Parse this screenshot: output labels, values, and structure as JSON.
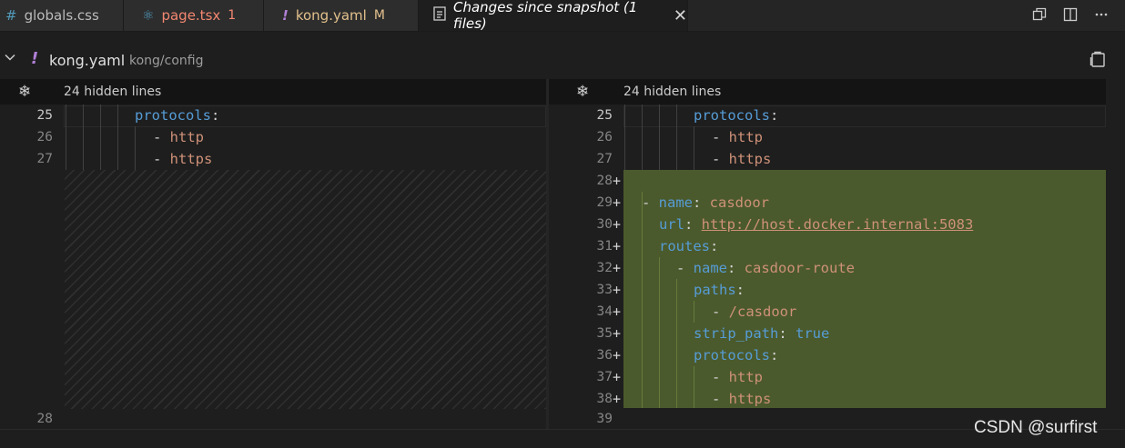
{
  "tabs": [
    {
      "icon": "#",
      "label": "globals.css",
      "badge": ""
    },
    {
      "icon": "⚛",
      "label": "page.tsx",
      "badge": "1"
    },
    {
      "icon": "!",
      "label": "kong.yaml",
      "badge": "M"
    },
    {
      "icon": "",
      "label": "Changes since snapshot (1 files)",
      "badge": ""
    }
  ],
  "colors": {
    "tab_error": "#f48771",
    "tab_modified": "#e2c08d",
    "added_bg": "#4b5a2c",
    "yaml_key": "#569cd6",
    "yaml_string": "#ce9178"
  },
  "header": {
    "file_name": "kong.yaml",
    "file_path": "kong/config"
  },
  "left": {
    "hidden_lines": "24 hidden lines",
    "lines": [
      {
        "num": "25",
        "text_key": "protocols",
        "colon": ":"
      },
      {
        "num": "26",
        "dash": "- ",
        "value": "http"
      },
      {
        "num": "27",
        "dash": "- ",
        "value": "https"
      }
    ],
    "last_line": "28"
  },
  "right": {
    "hidden_lines": "24 hidden lines",
    "lines": [
      {
        "num": "25",
        "text_key": "protocols",
        "colon": ":"
      },
      {
        "num": "26",
        "dash": "- ",
        "value": "http"
      },
      {
        "num": "27",
        "dash": "- ",
        "value": "https"
      }
    ],
    "added": [
      {
        "num": "28",
        "marker": "+"
      },
      {
        "num": "29",
        "marker": "+",
        "dash": "- ",
        "key": "name",
        "colon": ": ",
        "value": "casdoor"
      },
      {
        "num": "30",
        "marker": "+",
        "key": "url",
        "colon": ": ",
        "value": "http://host.docker.internal:5083"
      },
      {
        "num": "31",
        "marker": "+",
        "key": "routes",
        "colon": ":"
      },
      {
        "num": "32",
        "marker": "+",
        "dash": "- ",
        "key": "name",
        "colon": ": ",
        "value": "casdoor-route"
      },
      {
        "num": "33",
        "marker": "+",
        "key": "paths",
        "colon": ":"
      },
      {
        "num": "34",
        "marker": "+",
        "dash": "- ",
        "value": "/casdoor"
      },
      {
        "num": "35",
        "marker": "+",
        "key": "strip_path",
        "colon": ": ",
        "bool": "true"
      },
      {
        "num": "36",
        "marker": "+",
        "key": "protocols",
        "colon": ":"
      },
      {
        "num": "37",
        "marker": "+",
        "dash": "- ",
        "value": "http"
      },
      {
        "num": "38",
        "marker": "+",
        "dash": "- ",
        "value": "https"
      }
    ],
    "last_line": "39"
  },
  "watermark": "CSDN @surfirst"
}
